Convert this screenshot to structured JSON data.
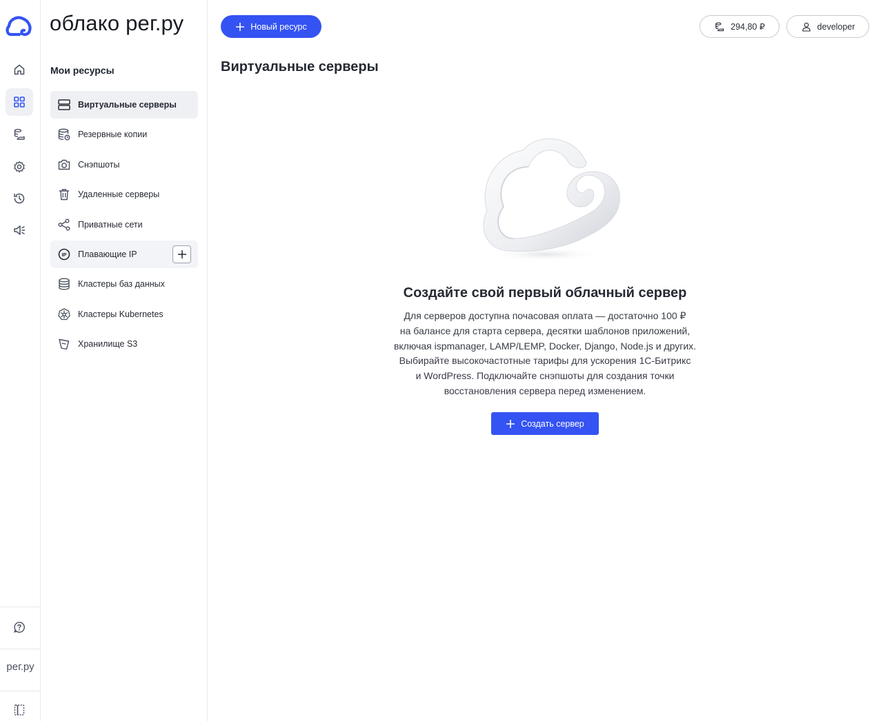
{
  "app": {
    "brand_title": "облако рег.ру",
    "rail_brand": "рег.ру"
  },
  "rail": {
    "items": [
      {
        "icon": "home-icon",
        "active": false
      },
      {
        "icon": "grid-icon",
        "active": true
      },
      {
        "icon": "billing-icon",
        "active": false
      },
      {
        "icon": "gear-icon",
        "active": false
      },
      {
        "icon": "history-icon",
        "active": false
      },
      {
        "icon": "announcements-icon",
        "active": false
      }
    ],
    "bottom": [
      {
        "icon": "help-icon"
      },
      {
        "icon": "collapse-sidebar-icon"
      }
    ]
  },
  "sidebar": {
    "section_title": "Мои ресурсы",
    "items": [
      {
        "label": "Виртуальные серверы",
        "icon": "server-icon",
        "active": true
      },
      {
        "label": "Резервные копии",
        "icon": "backup-icon"
      },
      {
        "label": "Снэпшоты",
        "icon": "camera-icon"
      },
      {
        "label": "Удаленные серверы",
        "icon": "trash-icon"
      },
      {
        "label": "Приватные сети",
        "icon": "network-icon"
      },
      {
        "label": "Плавающие IP",
        "icon": "ip-icon",
        "hover": true
      },
      {
        "label": "Кластеры баз данных",
        "icon": "database-icon"
      },
      {
        "label": "Кластеры Kubernetes",
        "icon": "kubernetes-icon"
      },
      {
        "label": "Хранилище S3",
        "icon": "storage-icon"
      }
    ]
  },
  "header": {
    "new_resource_label": "Новый ресурс",
    "balance": "294,80 ₽",
    "user": "developer"
  },
  "main": {
    "title": "Виртуальные серверы",
    "empty": {
      "title": "Создайте свой первый облачный сервер",
      "lines": [
        "Для серверов доступна почасовая оплата — достаточно 100 ₽",
        "на балансе для старта сервера, десятки шаблонов приложений,",
        "включая ispmanager, LAMP/LEMP, Docker, Django, Node.js и других.",
        "Выбирайте высокочастотные тарифы для ускорения 1С-Битрикс",
        "и WordPress. Подключайте снэпшоты для создания точки",
        "восстановления сервера перед изменением."
      ],
      "button_label": "Создать сервер"
    }
  },
  "colors": {
    "accent": "#3453f2",
    "active_bg": "#eef0f4",
    "border": "#e7e9ee"
  }
}
